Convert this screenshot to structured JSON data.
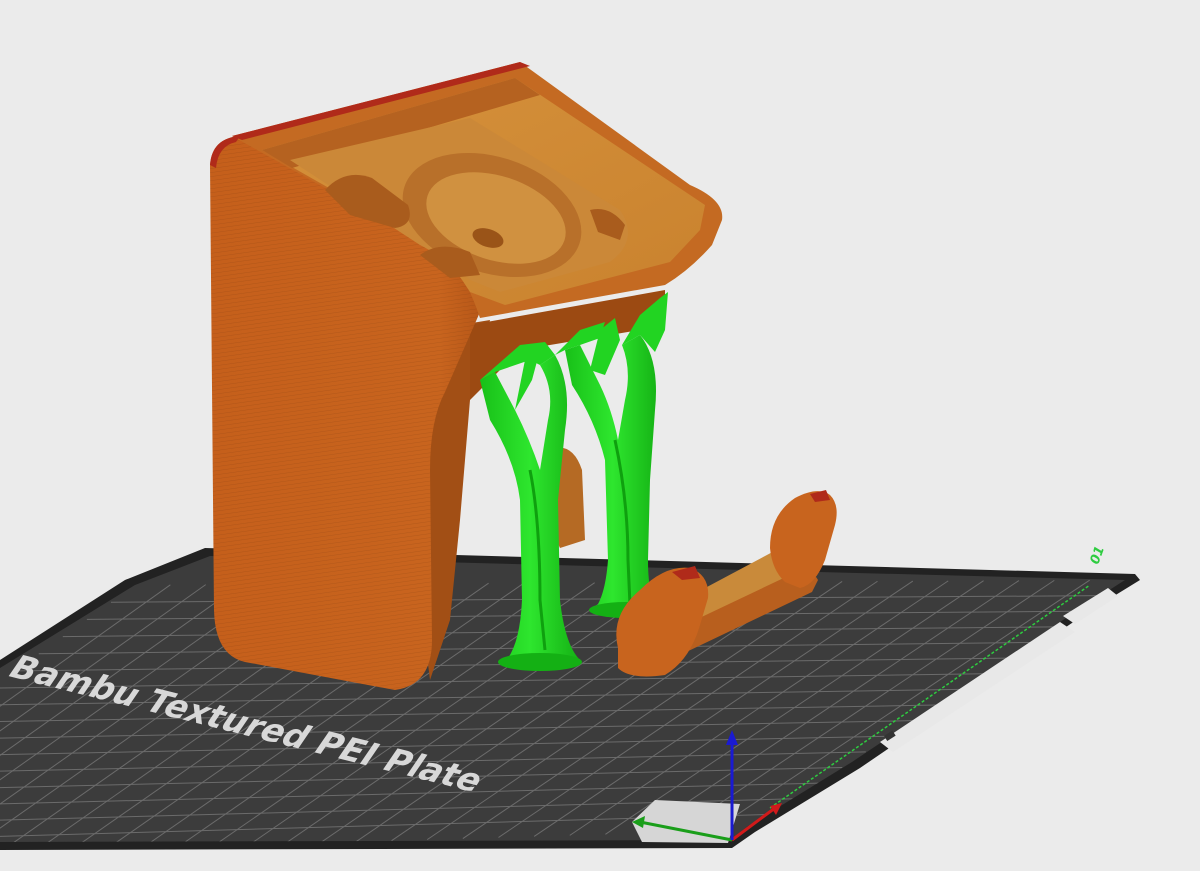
{
  "viewport": {
    "background": "#ebebeb"
  },
  "build_plate": {
    "label": "Bambu Textured PEI Plate",
    "plate_number": "01",
    "colors": {
      "plate": "#3c3c3c",
      "grid": "#6b6b6b",
      "border": "#202020",
      "label": "#d8d8d8",
      "plate_number": "#2ecc40"
    }
  },
  "model": {
    "colors": {
      "filament": "#c8641e",
      "filament_light": "#d9883a",
      "filament_dark": "#a04e14",
      "edge_highlight": "#b02a1a",
      "support": "#1fd81f",
      "support_dark": "#14b014"
    }
  },
  "axes": {
    "x_color": "#d11a1a",
    "y_color": "#1a9e1a",
    "z_color": "#1a1ad1"
  }
}
